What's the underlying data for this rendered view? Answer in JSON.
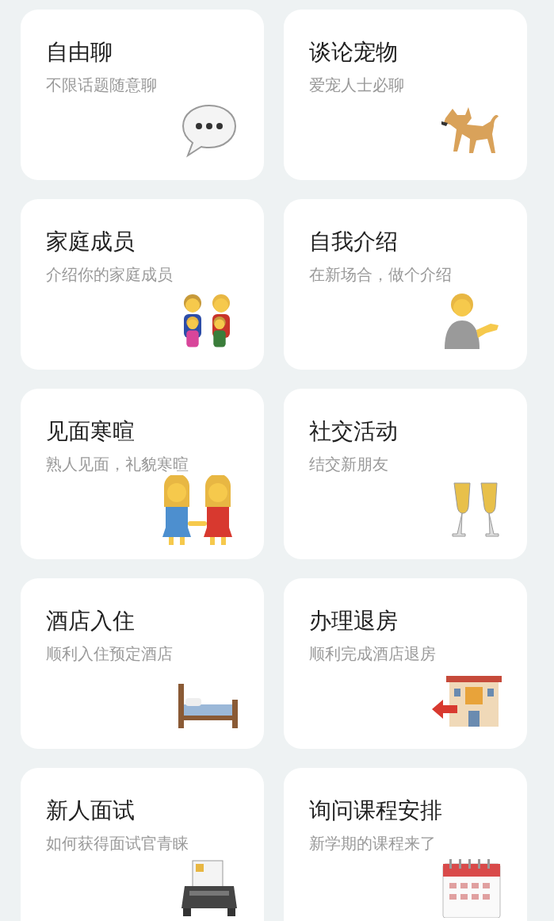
{
  "cards": [
    {
      "title": "自由聊",
      "subtitle": "不限话题随意聊",
      "kind": "speech"
    },
    {
      "title": "谈论宠物",
      "subtitle": "爱宠人士必聊",
      "kind": "dog"
    },
    {
      "title": "家庭成员",
      "subtitle": "介绍你的家庭成员",
      "kind": "family"
    },
    {
      "title": "自我介绍",
      "subtitle": "在新场合，做个介绍",
      "kind": "person"
    },
    {
      "title": "见面寒暄",
      "subtitle": "熟人见面，礼貌寒暄",
      "kind": "couple"
    },
    {
      "title": "社交活动",
      "subtitle": "结交新朋友",
      "kind": "champagne"
    },
    {
      "title": "酒店入住",
      "subtitle": "顺利入住预定酒店",
      "kind": "bed"
    },
    {
      "title": "办理退房",
      "subtitle": "顺利完成酒店退房",
      "kind": "hotel"
    },
    {
      "title": "新人面试",
      "subtitle": "如何获得面试官青睐",
      "kind": "fax"
    },
    {
      "title": "询问课程安排",
      "subtitle": "新学期的课程来了",
      "kind": "calendar"
    }
  ]
}
